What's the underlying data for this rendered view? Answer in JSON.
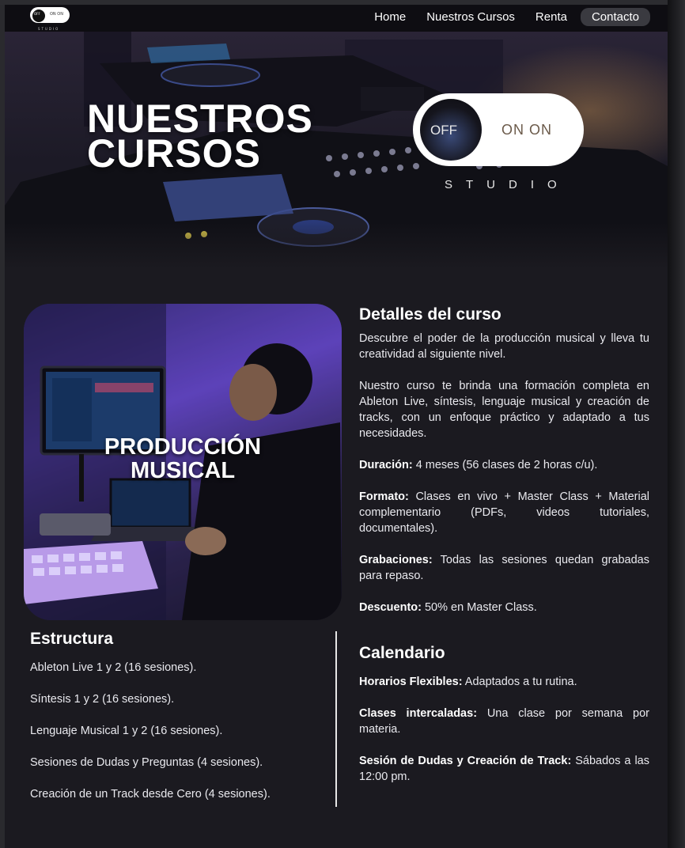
{
  "nav": {
    "logo": {
      "off": "OFF",
      "on": "ON ON",
      "studio": "STUDIO"
    },
    "links": [
      "Home",
      "Nuestros Cursos",
      "Renta",
      "Contacto"
    ]
  },
  "hero": {
    "title_line1": "NUESTROS",
    "title_line2": "CURSOS",
    "logo_off": "OFF",
    "logo_on": "ON ON",
    "logo_studio": "STUDIO"
  },
  "course": {
    "title_line1": "PRODUCCIÓN",
    "title_line2": "MUSICAL"
  },
  "details": {
    "heading": "Detalles del curso",
    "intro": "Descubre el poder de la producción musical y lleva tu creatividad al siguiente nivel.",
    "description": "Nuestro curso te brinda una formación completa en Ableton Live, síntesis, lenguaje musical y creación de tracks, con un enfoque práctico y adaptado a tus necesidades.",
    "duracion_label": "Duración:",
    "duracion_value": " 4 meses (56 clases de 2 horas c/u).",
    "formato_label": "Formato:",
    "formato_value": " Clases en vivo + Master Class + Material complementario (PDFs, videos tutoriales, documentales).",
    "grabaciones_label": "Grabaciones:",
    "grabaciones_value": " Todas las sesiones quedan grabadas para repaso.",
    "descuento_label": "Descuento:",
    "descuento_value": " 50% en Master Class."
  },
  "estructura": {
    "heading": "Estructura",
    "items": [
      "Ableton Live 1 y 2 (16 sesiones).",
      "Síntesis 1 y 2 (16 sesiones).",
      "Lenguaje Musical 1 y 2 (16 sesiones).",
      "Sesiones de Dudas y Preguntas (4 sesiones).",
      "Creación de un Track desde Cero (4 sesiones)."
    ]
  },
  "calendario": {
    "heading": "Calendario",
    "horarios_label": "Horarios Flexibles:",
    "horarios_value": " Adaptados a tu rutina.",
    "clases_label": "Clases intercaladas:",
    "clases_value": " Una clase por semana por materia.",
    "sesion_label": "Sesión de Dudas y Creación de Track:",
    "sesion_value": " Sábados a las 12:00 pm."
  }
}
